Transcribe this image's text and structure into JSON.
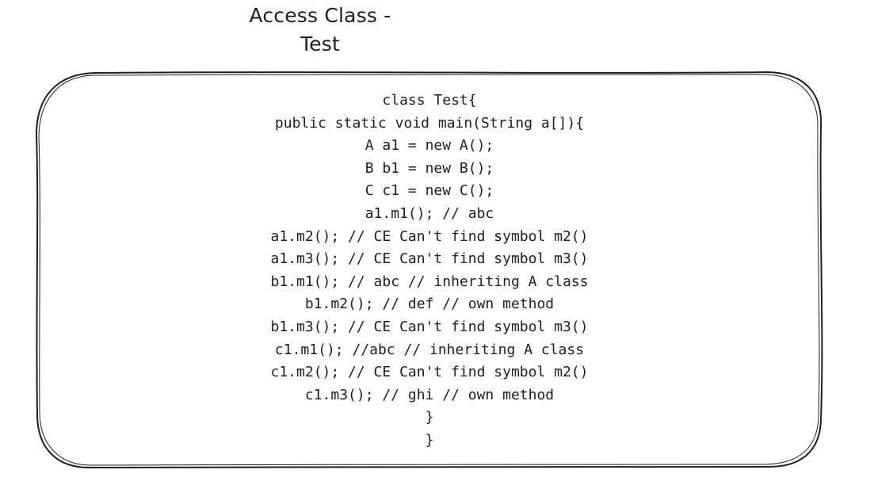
{
  "title": {
    "line1": "Access Class -",
    "line2": "Test"
  },
  "code_lines": [
    "class Test{",
    "public static void main(String a[]){",
    "A a1 = new A();",
    "B b1 = new B();",
    "C c1 = new C();",
    "a1.m1(); // abc",
    "a1.m2(); // CE Can't find symbol m2()",
    "a1.m3(); // CE Can't find symbol m3()",
    "b1.m1(); // abc // inheriting A class",
    "b1.m2(); // def // own method",
    "b1.m3(); // CE Can't find symbol m3()",
    "c1.m1(); //abc // inheriting A class",
    "c1.m2(); // CE Can't find symbol m2()",
    "c1.m3(); // ghi // own method",
    "}",
    "}"
  ],
  "colors": {
    "stroke": "#1e1e1e",
    "text": "#1e1e1e",
    "background": "#ffffff"
  }
}
